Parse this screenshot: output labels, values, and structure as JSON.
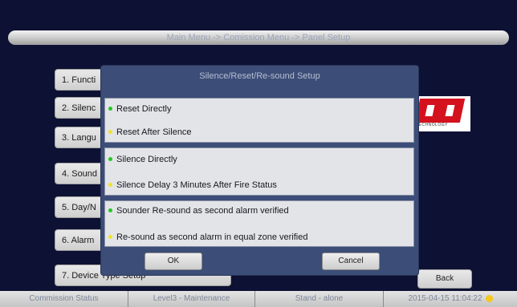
{
  "header": {
    "breadcrumb": "Main Menu -> Comission Menu -> Panel Setup"
  },
  "menu": [
    {
      "label": "1. Functi"
    },
    {
      "label": "2. Silenc"
    },
    {
      "label": "3. Langu"
    },
    {
      "label": "4. Sound"
    },
    {
      "label": "5. Day/N"
    },
    {
      "label": "6. Alarm"
    },
    {
      "label": "7. Device Type Setup"
    }
  ],
  "logo": {
    "subtext": "TECHNOLOGY"
  },
  "dialog": {
    "title": "Silence/Reset/Re-sound Setup",
    "groups": [
      {
        "options": [
          {
            "label": "Reset Directly",
            "status": "green"
          },
          {
            "label": "Reset After Silence",
            "status": "yellow"
          }
        ]
      },
      {
        "options": [
          {
            "label": "Silence Directly",
            "status": "green"
          },
          {
            "label": "Silence Delay 3 Minutes After Fire Status",
            "status": "yellow"
          }
        ]
      },
      {
        "options": [
          {
            "label": "Sounder Re-sound as second alarm verified",
            "status": "green"
          },
          {
            "label": "Re-sound as second alarm in equal zone verified",
            "status": "yellow"
          }
        ]
      }
    ],
    "ok_label": "OK",
    "cancel_label": "Cancel"
  },
  "back_label": "Back",
  "status_bar": {
    "mode": "Commission Status",
    "level": "Level3 - Maintenance",
    "network": "Stand - alone",
    "datetime": "2015-04-15 11:04:22"
  },
  "colors": {
    "background": "#0d1133",
    "dialog": "#3c4d77",
    "selected_dot": "#22c822",
    "unselected_dot": "#f2e12a",
    "status_indicator": "#f4c81c"
  }
}
